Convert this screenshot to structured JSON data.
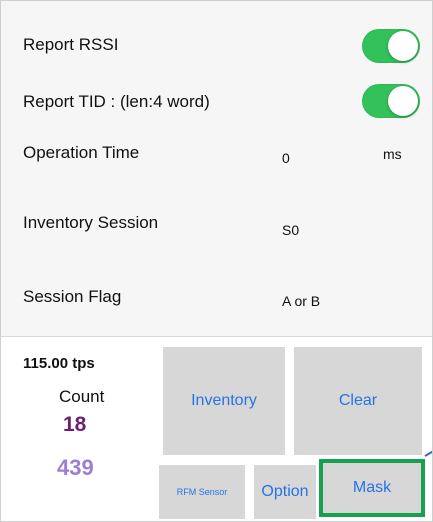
{
  "settings": {
    "report_rssi": {
      "label": "Report RSSI",
      "enabled": true
    },
    "report_tid": {
      "label": "Report TID : (len:4 word)",
      "enabled": true
    },
    "operation_time": {
      "label": "Operation Time",
      "value": "0",
      "unit": "ms"
    },
    "inventory_session": {
      "label": "Inventory Session",
      "value": "S0"
    },
    "session_flag": {
      "label": "Session Flag",
      "value": "A or B"
    }
  },
  "stats": {
    "rate": "115.00 tps",
    "count_label": "Count",
    "count_primary": "18",
    "count_secondary": "439"
  },
  "buttons": {
    "inventory": "Inventory",
    "clear": "Clear",
    "rfm_sensor": "RFM Sensor",
    "option": "Option",
    "mask": "Mask"
  },
  "colors": {
    "toggle_on": "#33c15a",
    "button_bg": "#d7d7d7",
    "button_text": "#2673e6",
    "count_primary": "#6b1f6e",
    "count_secondary": "#9b7fd6",
    "highlight": "#17a14f"
  }
}
